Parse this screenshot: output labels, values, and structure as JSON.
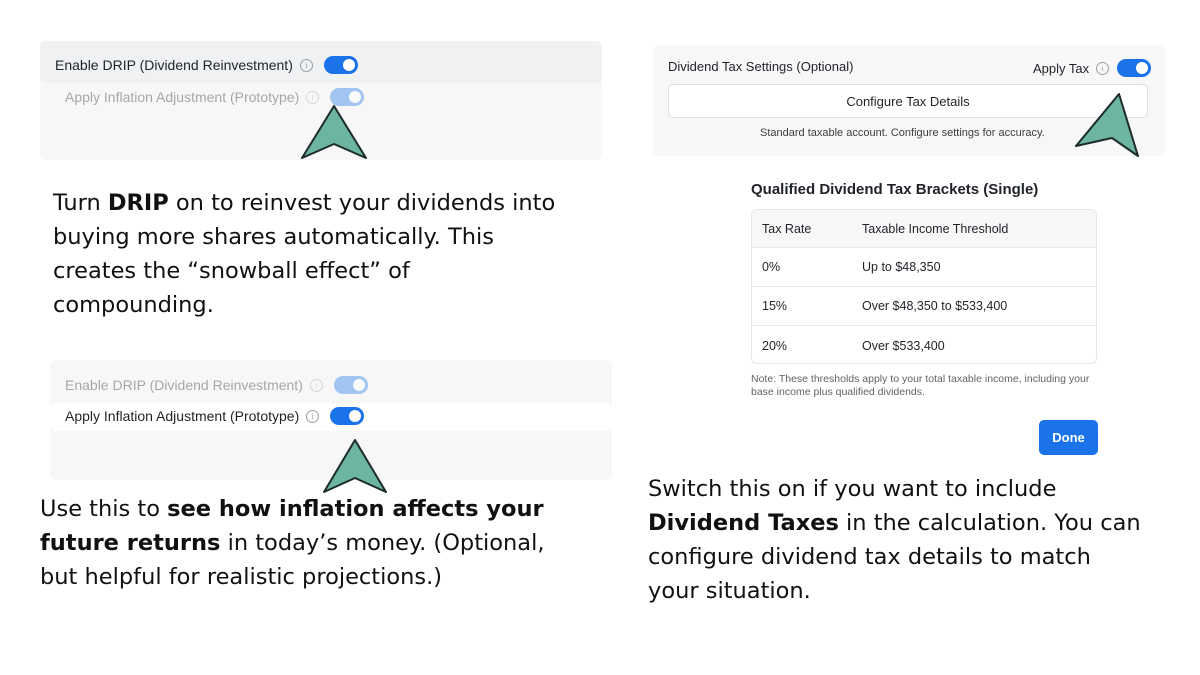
{
  "panel1": {
    "drip_label": "Enable DRIP (Dividend Reinvestment)",
    "inflation_label": "Apply Inflation Adjustment (Prototype)"
  },
  "caption1": {
    "pre": "Turn ",
    "bold": "DRIP",
    "post": " on to reinvest your dividends into buying more shares automatically. This creates the “snowball effect” of compounding."
  },
  "panel2": {
    "drip_label": "Enable DRIP (Dividend Reinvestment)",
    "inflation_label": "Apply Inflation Adjustment (Prototype)"
  },
  "caption2": {
    "pre": "Use this to ",
    "bold": "see how inflation affects your future returns",
    "post": " in today’s money. (Optional, but helpful for realistic projections.)"
  },
  "tax_panel": {
    "title": "Dividend Tax Settings (Optional)",
    "apply_label": "Apply Tax",
    "configure_button": "Configure Tax Details",
    "note": "Standard taxable account. Configure settings for accuracy."
  },
  "brackets": {
    "title": "Qualified Dividend Tax Brackets (Single)",
    "headers": [
      "Tax Rate",
      "Taxable Income Threshold"
    ],
    "rows": [
      [
        "0%",
        "Up to $48,350"
      ],
      [
        "15%",
        "Over $48,350 to $533,400"
      ],
      [
        "20%",
        "Over $533,400"
      ]
    ],
    "note": "Note: These thresholds apply to your total taxable income, including your base income plus qualified dividends.",
    "done_button": "Done"
  },
  "caption3": {
    "pre": "Switch this on if you want to include ",
    "bold": "Dividend Taxes",
    "post": " in the calculation. You can configure dividend tax details to match your situation."
  },
  "icons": {
    "info": "info-icon",
    "pointer": "arrow-pointer-icon",
    "toggle": "toggle-switch"
  },
  "colors": {
    "accent": "#1a73e8",
    "arrow_fill": "#6cb5a0",
    "panel_bg": "#f7f7f8"
  }
}
